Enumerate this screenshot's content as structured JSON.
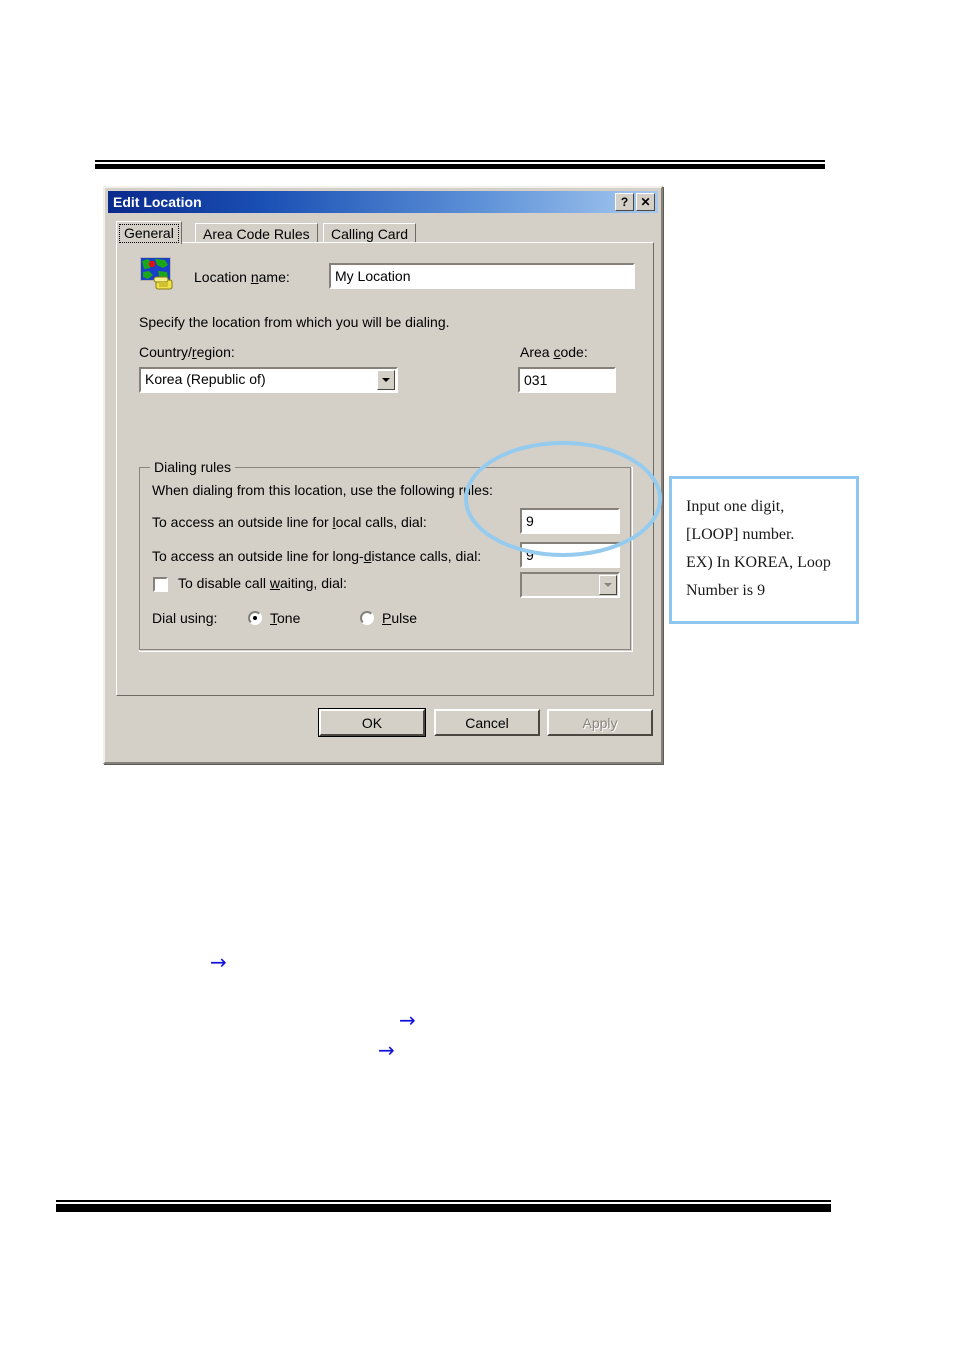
{
  "dialog": {
    "title": "Edit Location",
    "title_buttons": [
      {
        "name": "help-button",
        "glyph": "?"
      },
      {
        "name": "close-button",
        "glyph": "✕"
      }
    ],
    "tabs": [
      {
        "label": "General",
        "active": true
      },
      {
        "label": "Area Code Rules",
        "active": false
      },
      {
        "label": "Calling Card",
        "active": false
      }
    ],
    "general": {
      "location_icon": "map-with-telephone-icon",
      "location_name_label": "Location name:",
      "location_name_value": "My Location",
      "description": "Specify the location from which you will be dialing.",
      "country_label": "Country/region:",
      "country_value": "Korea (Republic of)",
      "area_code_label": "Area code:",
      "area_code_value": "031",
      "dialing_rules": {
        "group_title": "Dialing rules",
        "intro": "When dialing from this location, use the following rules:",
        "local_label": "To access an outside line for local calls, dial:",
        "local_value": "9",
        "long_distance_label": "To access an outside line for long-distance calls, dial:",
        "long_distance_value": "9",
        "call_waiting_label": "To disable call waiting, dial:",
        "call_waiting_checked": false,
        "call_waiting_value": "",
        "dial_using_label": "Dial using:",
        "dial_tone_label": "Tone",
        "dial_pulse_label": "Pulse",
        "dial_using_selected": "Tone"
      }
    },
    "buttons": {
      "ok": "OK",
      "cancel": "Cancel",
      "apply": "Apply"
    }
  },
  "annotation": {
    "callout_lines": [
      "Input one digit,",
      "[LOOP] number.",
      "EX) In KOREA, Loop",
      "Number is  9"
    ],
    "highlight_color": "#95cbee",
    "callout_border_color": "#8ec6ef",
    "arrow_glyph": "→",
    "arrow_color": "#1111dd"
  }
}
